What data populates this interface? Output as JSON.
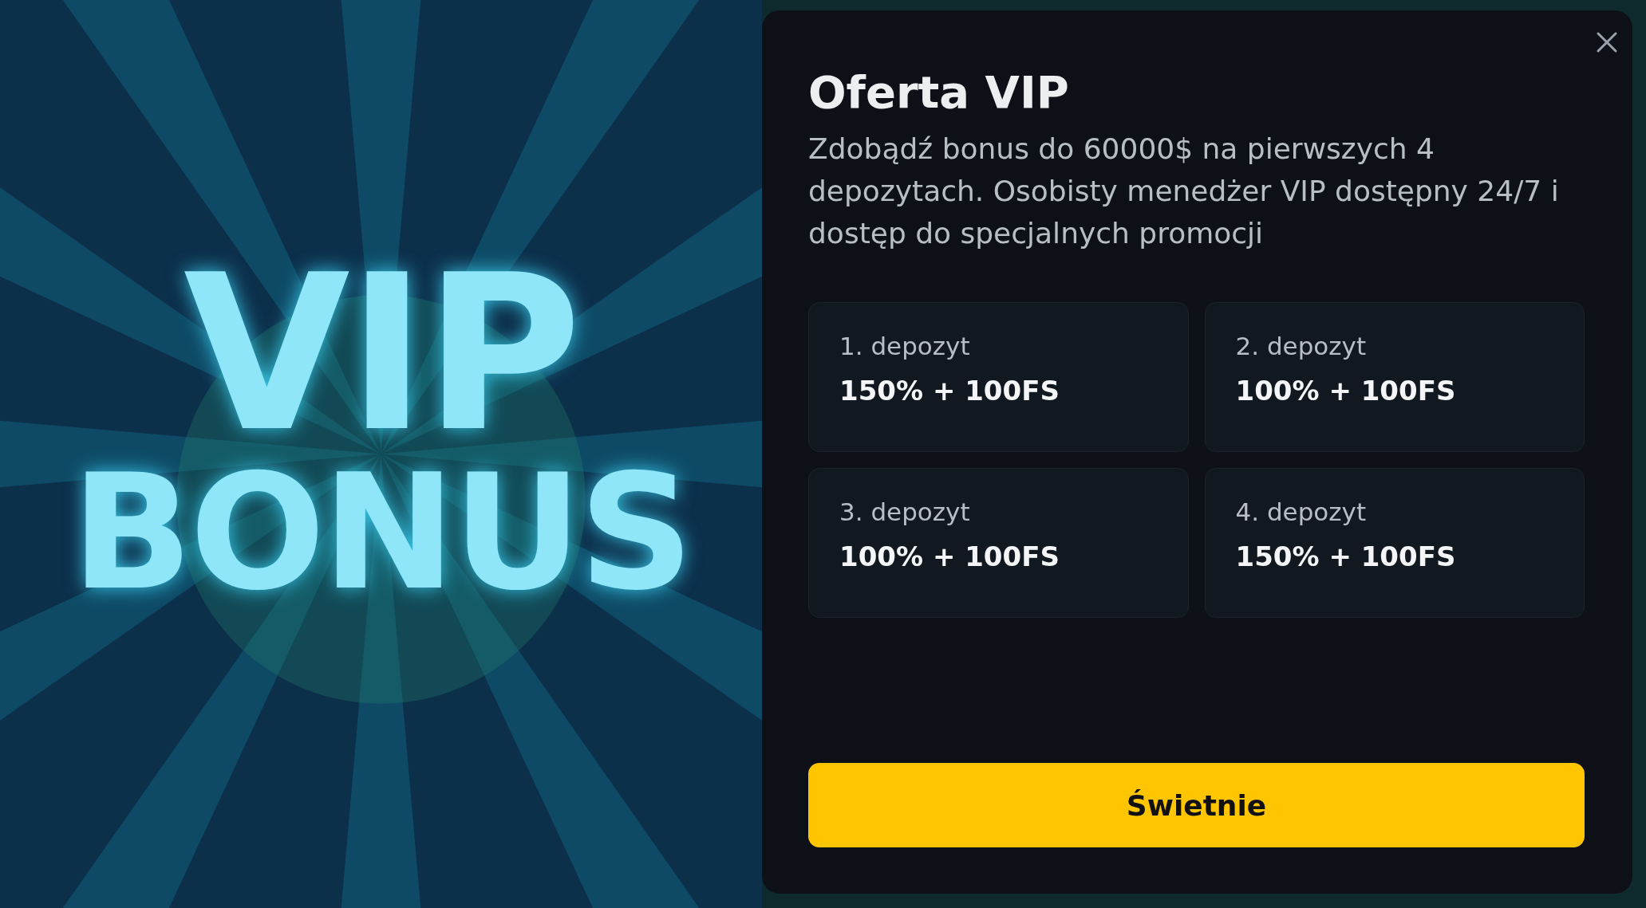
{
  "banner": {
    "lines": [
      "VIP",
      "BONUS"
    ]
  },
  "dialog": {
    "title": "Oferta VIP",
    "description": "Zdobądź bonus do 60000$ na pierwszych 4 depozytach. Osobisty menedżer VIP dostępny 24/7 i dostęp do specjalnych promocji",
    "deposits": [
      {
        "label": "1. depozyt",
        "value": "150% + 100FS"
      },
      {
        "label": "2. depozyt",
        "value": "100% + 100FS"
      },
      {
        "label": "3. depozyt",
        "value": "100% + 100FS"
      },
      {
        "label": "4. depozyt",
        "value": "150% + 100FS"
      }
    ],
    "button": "Świetnie"
  }
}
